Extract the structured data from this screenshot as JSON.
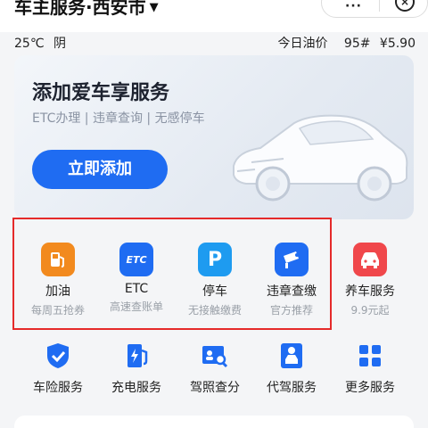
{
  "header": {
    "title": "车主服务·西安市",
    "caret": "▼",
    "more": "···",
    "close": "⊗"
  },
  "weather": {
    "temp": "25℃",
    "condition": "阴"
  },
  "oil": {
    "label": "今日油价",
    "grade": "95#",
    "price": "¥5.90"
  },
  "banner": {
    "title": "添加爱车享服务",
    "subtitle": "ETC办理 | 违章查询 | 无感停车",
    "button": "立即添加"
  },
  "services_row1": [
    {
      "name": "加油",
      "sub": "每周五抢券",
      "icon": "fuel-pump-icon",
      "color": "#f28a1e"
    },
    {
      "name": "ETC",
      "sub": "高速查账单",
      "icon": "etc-icon",
      "color": "#1f6cf2"
    },
    {
      "name": "停车",
      "sub": "无接触缴费",
      "icon": "parking-icon",
      "color": "#1e9bf0"
    },
    {
      "name": "违章查缴",
      "sub": "官方推荐",
      "icon": "camera-icon",
      "color": "#1f6cf2"
    },
    {
      "name": "养车服务",
      "sub": "9.9元起",
      "icon": "car-service-icon",
      "color": "#f0474b"
    }
  ],
  "services_row2": [
    {
      "name": "车险服务",
      "icon": "shield-check-icon"
    },
    {
      "name": "充电服务",
      "icon": "charging-icon"
    },
    {
      "name": "驾照查分",
      "icon": "license-search-icon"
    },
    {
      "name": "代驾服务",
      "icon": "driver-icon"
    },
    {
      "name": "更多服务",
      "icon": "grid-icon"
    }
  ],
  "icon_color": "#1f6cf2",
  "highlight_color": "#e52a2a"
}
